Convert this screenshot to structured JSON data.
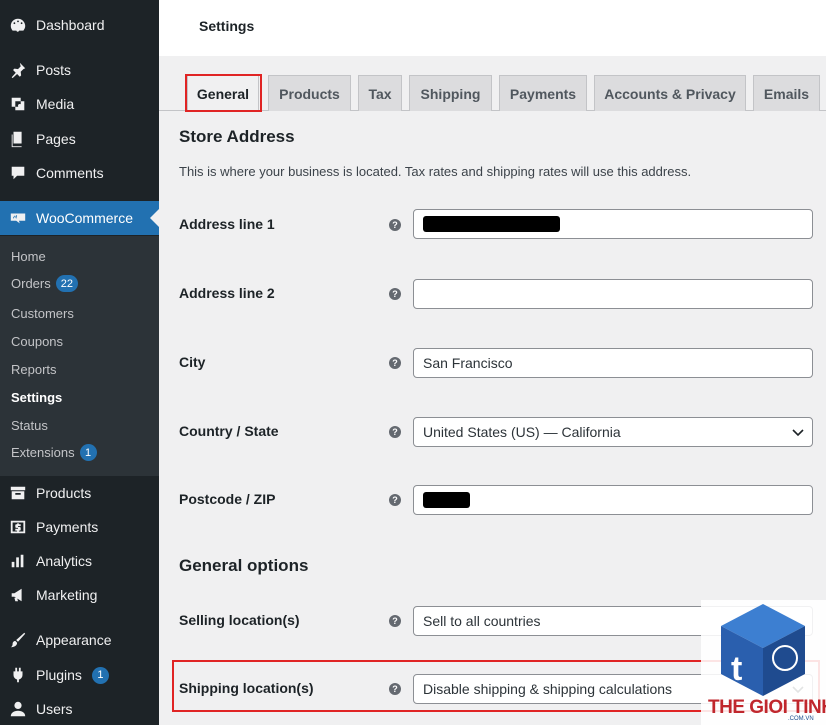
{
  "sidebar": {
    "top_items": [
      {
        "label": "Dashboard",
        "icon": "dashboard-icon"
      },
      {
        "label": "Posts",
        "icon": "pin-icon"
      },
      {
        "label": "Media",
        "icon": "media-icon"
      },
      {
        "label": "Pages",
        "icon": "pages-icon"
      },
      {
        "label": "Comments",
        "icon": "comment-icon"
      }
    ],
    "woocommerce": {
      "label": "WooCommerce",
      "icon": "woocommerce-icon"
    },
    "submenu": [
      {
        "label": "Home"
      },
      {
        "label": "Orders",
        "badge": "22"
      },
      {
        "label": "Customers"
      },
      {
        "label": "Coupons"
      },
      {
        "label": "Reports"
      },
      {
        "label": "Settings"
      },
      {
        "label": "Status"
      },
      {
        "label": "Extensions",
        "badge": "1"
      }
    ],
    "bottom_items": [
      {
        "label": "Products",
        "icon": "archive-icon"
      },
      {
        "label": "Payments",
        "icon": "dollar-icon"
      },
      {
        "label": "Analytics",
        "icon": "bar-chart-icon"
      },
      {
        "label": "Marketing",
        "icon": "megaphone-icon"
      },
      {
        "label": "Appearance",
        "icon": "brush-icon"
      },
      {
        "label": "Plugins",
        "icon": "plug-icon",
        "badge": "1"
      },
      {
        "label": "Users",
        "icon": "users-icon"
      }
    ]
  },
  "header": {
    "title": "Settings"
  },
  "tabs": [
    "General",
    "Products",
    "Tax",
    "Shipping",
    "Payments",
    "Accounts & Privacy",
    "Emails"
  ],
  "store_address": {
    "heading": "Store Address",
    "description": "This is where your business is located. Tax rates and shipping rates will use this address.",
    "fields": {
      "address1": {
        "label": "Address line 1",
        "value": ""
      },
      "address2": {
        "label": "Address line 2",
        "value": ""
      },
      "city": {
        "label": "City",
        "value": "San Francisco"
      },
      "country": {
        "label": "Country / State",
        "value": "United States (US) — California"
      },
      "postcode": {
        "label": "Postcode / ZIP",
        "value": ""
      }
    }
  },
  "general_options": {
    "heading": "General options",
    "selling": {
      "label": "Selling location(s)",
      "value": "Sell to all countries"
    },
    "shipping": {
      "label": "Shipping location(s)",
      "value": "Disable shipping & shipping calculations"
    }
  },
  "help_glyph": "?",
  "watermark": {
    "brand": "THE GIOI TINHOC",
    "sub": ".COM.VN"
  },
  "colors": {
    "sidebar": "#1d2327",
    "active": "#2271b1",
    "highlight": "#e02424"
  }
}
